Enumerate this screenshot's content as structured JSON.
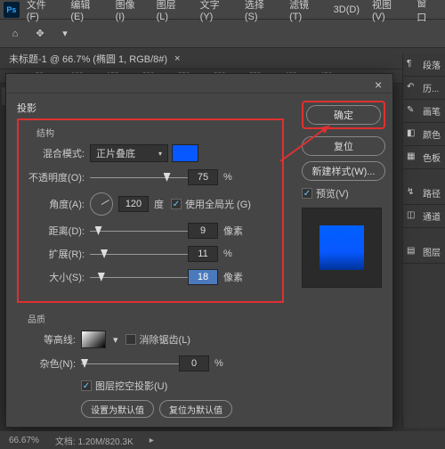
{
  "menu": {
    "items": [
      "文件(F)",
      "编辑(E)",
      "图像(I)",
      "图层(L)",
      "文字(Y)",
      "选择(S)",
      "滤镜(T)",
      "3D(D)",
      "视图(V)",
      "窗口"
    ]
  },
  "doc": {
    "title": "未标题-1 @ 66.7% (椭圆 1, RGB/8#)"
  },
  "ruler": {
    "ticks": [
      "50",
      "100",
      "150",
      "200",
      "250",
      "300",
      "350",
      "400",
      "450"
    ]
  },
  "panels": {
    "items": [
      "段落",
      "历...",
      "画笔",
      "颜色",
      "色板",
      "路径",
      "通道",
      "图层"
    ]
  },
  "dialog": {
    "title": "投影",
    "sub1": "结构",
    "blend_mode_label": "混合模式:",
    "blend_mode_value": "正片叠底",
    "opacity_label": "不透明度(O):",
    "opacity_value": "75",
    "opacity_unit": "%",
    "angle_label": "角度(A):",
    "angle_value": "120",
    "angle_unit": "度",
    "global_light": "使用全局光 (G)",
    "distance_label": "距离(D):",
    "distance_value": "9",
    "spread_label": "扩展(R):",
    "spread_value": "11",
    "spread_unit": "%",
    "size_label": "大小(S):",
    "size_value": "18",
    "px_unit": "像素",
    "sub2": "品质",
    "contour_label": "等高线:",
    "antialias": "消除锯齿(L)",
    "noise_label": "杂色(N):",
    "noise_value": "0",
    "knockout": "图层挖空投影(U)",
    "set_default": "设置为默认值",
    "reset_default": "复位为默认值",
    "ok": "确定",
    "reset": "复位",
    "new_style": "新建样式(W)...",
    "preview": "预览(V)"
  },
  "status": {
    "zoom": "66.67%",
    "doc_info": "文档: 1.20M/820.3K"
  }
}
